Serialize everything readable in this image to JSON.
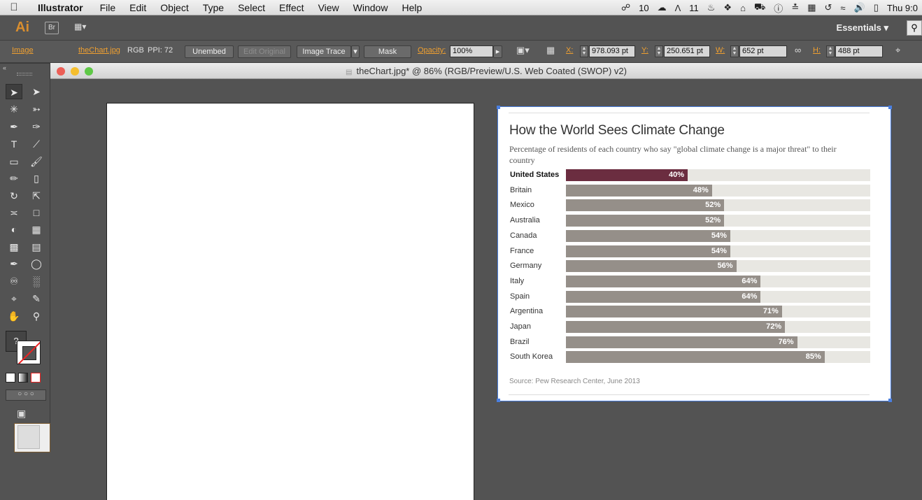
{
  "menubar": {
    "apple_icon": "apple-logo",
    "app_name": "Illustrator",
    "items": [
      "File",
      "Edit",
      "Object",
      "Type",
      "Select",
      "Effect",
      "View",
      "Window",
      "Help"
    ],
    "status": {
      "creative_cloud_count": "10",
      "adobe_count": "11",
      "clock": "Thu 9:0"
    }
  },
  "appbar": {
    "logo": "Ai",
    "bridge": "Br",
    "workspace": "Essentials"
  },
  "control": {
    "object_type": "Image",
    "file_name": "theChart.jpg",
    "color_mode": "RGB",
    "ppi": "PPI: 72",
    "unembed": "Unembed",
    "edit_original": "Edit Original",
    "image_trace": "Image Trace",
    "mask": "Mask",
    "opacity_label": "Opacity:",
    "opacity_value": "100%",
    "x_label": "X:",
    "x_value": "978.093 pt",
    "y_label": "Y:",
    "y_value": "250.651 pt",
    "w_label": "W:",
    "w_value": "652 pt",
    "h_label": "H:",
    "h_value": "488 pt"
  },
  "document": {
    "title": "theChart.jpg* @ 86% (RGB/Preview/U.S. Web Coated (SWOP) v2)"
  },
  "tools": {
    "fill_unknown": "?"
  },
  "chart": {
    "title": "How the World Sees Climate Change",
    "subtitle": "Percentage of residents of each country who say \"global climate change is a major threat\" to their country",
    "source": "Source: Pew Research Center, June 2013",
    "colors": {
      "highlight": "#6b2d40",
      "bar": "#958f89",
      "track": "#e8e7e2"
    }
  },
  "chart_data": {
    "type": "bar",
    "orientation": "horizontal",
    "title": "How the World Sees Climate Change",
    "subtitle": "Percentage of residents of each country who say \"global climate change is a major threat\" to their country",
    "categories": [
      "United States",
      "Britain",
      "Mexico",
      "Australia",
      "Canada",
      "France",
      "Germany",
      "Italy",
      "Spain",
      "Argentina",
      "Japan",
      "Brazil",
      "South Korea"
    ],
    "values": [
      40,
      48,
      52,
      52,
      54,
      54,
      56,
      64,
      64,
      71,
      72,
      76,
      85
    ],
    "value_labels": [
      "40%",
      "48%",
      "52%",
      "52%",
      "54%",
      "54%",
      "56%",
      "64%",
      "64%",
      "71%",
      "72%",
      "76%",
      "85%"
    ],
    "highlight": "United States",
    "xlim": [
      0,
      100
    ],
    "grid": false,
    "source": "Source: Pew Research Center, June 2013"
  }
}
